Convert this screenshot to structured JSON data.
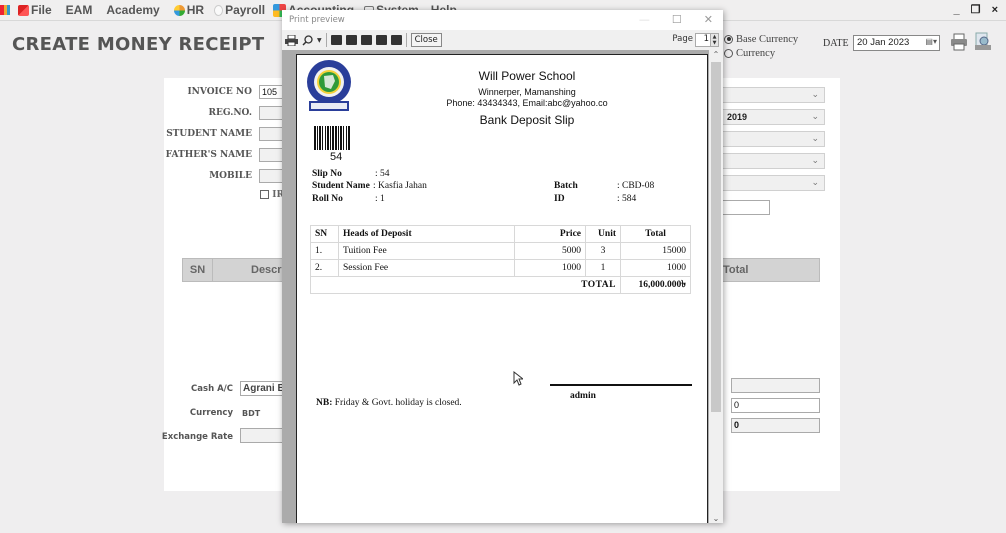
{
  "menubar": {
    "items": [
      {
        "label": "File",
        "icon": "file-menu-icon"
      },
      {
        "label": "EAM",
        "icon": ""
      },
      {
        "label": "Academy",
        "icon": ""
      },
      {
        "label": "HR",
        "icon": "hr-globe-icon"
      },
      {
        "label": "Payroll",
        "icon": "payroll-icon"
      },
      {
        "label": "Accounting",
        "icon": "accounting-icon"
      },
      {
        "label": "System",
        "icon": "system-icon"
      },
      {
        "label": "Help",
        "icon": ""
      }
    ],
    "window_controls": [
      "_",
      "❐",
      "×"
    ]
  },
  "header": {
    "title": "CREATE MONEY RECEIPT",
    "currency_options": [
      {
        "label": "Base Currency",
        "selected": true
      },
      {
        "label": "Currency",
        "selected": false
      }
    ],
    "date_label": "DATE",
    "date_value": "20 Jan  2023"
  },
  "form": {
    "invoice_no": {
      "label": "INVOICE NO",
      "value": "105"
    },
    "reg_no": {
      "label": "REG.NO.",
      "value": ""
    },
    "student_name": {
      "label": "STUDENT NAME",
      "value": ""
    },
    "fathers_name": {
      "label": "FATHER'S NAME",
      "value": ""
    },
    "mobile": {
      "label": "MOBILE",
      "value": ""
    },
    "checkbox_label": "IR",
    "combos": [
      "",
      "2019",
      "",
      "",
      ""
    ],
    "grid_headers": {
      "sn": "SN",
      "description": "Descri",
      "total": "Total"
    },
    "cash_ac": {
      "label": "Cash A/C",
      "value": "Agrani B"
    },
    "currency": {
      "label": "Currency",
      "value": "BDT"
    },
    "exchange_rate": {
      "label": "Exchange Rate",
      "value": ""
    },
    "right_fields": [
      "",
      "0",
      "0"
    ]
  },
  "print_preview": {
    "title": "Print preview",
    "close_label": "Close",
    "page_label": "Page",
    "page_value": "1",
    "slip": {
      "school_name": "Will Power School",
      "address": "Winnerper, Mamanshing",
      "contact": "Phone: 43434343, Email:abc@yahoo.co",
      "doc_title": "Bank Deposit Slip",
      "barcode_number": "54",
      "slip_no_label": "Slip No",
      "slip_no": ": 54",
      "student_name_label": "Student Name",
      "student_name": ": Kasfia Jahan",
      "roll_no_label": "Roll No",
      "roll_no": ": 1",
      "batch_label": "Batch",
      "batch": ": CBD-08",
      "id_label": "ID",
      "id": ": 584",
      "table_headers": [
        "SN",
        "Heads of Deposit",
        "Price",
        "Unit",
        "Total"
      ],
      "rows": [
        {
          "sn": "1.",
          "head": "Tuition Fee",
          "price": "5000",
          "unit": "3",
          "total": "15000"
        },
        {
          "sn": "2.",
          "head": "Session Fee",
          "price": "1000",
          "unit": "1",
          "total": "1000"
        }
      ],
      "total_label": "TOTAL",
      "total_value": "16,000.000৳",
      "signature_name": "admin",
      "nb_label": "NB:",
      "nb_text": " Friday & Govt. holiday is closed."
    }
  }
}
